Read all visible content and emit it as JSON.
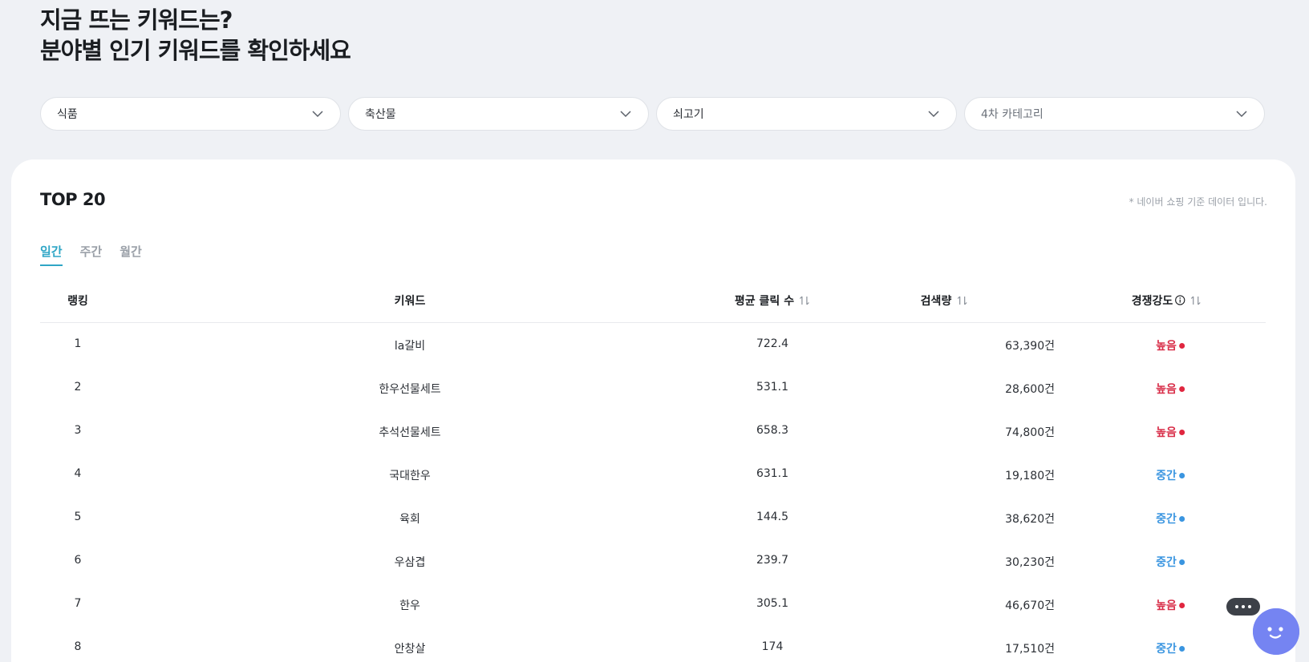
{
  "headline": {
    "line1": "지금 뜨는 키워드는?",
    "line2": "분야별 인기 키워드를 확인하세요"
  },
  "filters": [
    {
      "value": "식품",
      "placeholder": false
    },
    {
      "value": "축산물",
      "placeholder": false
    },
    {
      "value": "쇠고기",
      "placeholder": false
    },
    {
      "value": "4차 카테고리",
      "placeholder": true
    }
  ],
  "card": {
    "title": "TOP 20",
    "source_note": "* 네이버 쇼핑 기준 데이터 입니다.",
    "tabs": [
      {
        "label": "일간",
        "active": true
      },
      {
        "label": "주간",
        "active": false
      },
      {
        "label": "월간",
        "active": false
      }
    ]
  },
  "table": {
    "headers": {
      "rank": "랭킹",
      "keyword": "키워드",
      "avg_clicks": "평균 클릭 수",
      "search_volume": "검색량",
      "competition": "경쟁강도"
    },
    "rows": [
      {
        "rank": "1",
        "keyword": "la갈비",
        "avg_clicks": "722.4",
        "search_volume": "63,390건",
        "competition": "높음",
        "level": "high"
      },
      {
        "rank": "2",
        "keyword": "한우선물세트",
        "avg_clicks": "531.1",
        "search_volume": "28,600건",
        "competition": "높음",
        "level": "high"
      },
      {
        "rank": "3",
        "keyword": "추석선물세트",
        "avg_clicks": "658.3",
        "search_volume": "74,800건",
        "competition": "높음",
        "level": "high"
      },
      {
        "rank": "4",
        "keyword": "국대한우",
        "avg_clicks": "631.1",
        "search_volume": "19,180건",
        "competition": "중간",
        "level": "mid"
      },
      {
        "rank": "5",
        "keyword": "육회",
        "avg_clicks": "144.5",
        "search_volume": "38,620건",
        "competition": "중간",
        "level": "mid"
      },
      {
        "rank": "6",
        "keyword": "우삼겹",
        "avg_clicks": "239.7",
        "search_volume": "30,230건",
        "competition": "중간",
        "level": "mid"
      },
      {
        "rank": "7",
        "keyword": "한우",
        "avg_clicks": "305.1",
        "search_volume": "46,670건",
        "competition": "높음",
        "level": "high"
      },
      {
        "rank": "8",
        "keyword": "안창살",
        "avg_clicks": "174",
        "search_volume": "17,510건",
        "competition": "중간",
        "level": "mid"
      }
    ]
  },
  "colors": {
    "accent": "#2fa6c6",
    "high": "#d9304b",
    "mid": "#3a95e0"
  },
  "icons": {
    "select_arrow": "chevron-down-icon",
    "sort": "sort-arrows-icon",
    "info": "info-icon",
    "chat": "chat-bubble-icon",
    "bot": "chatbot-avatar-icon"
  }
}
